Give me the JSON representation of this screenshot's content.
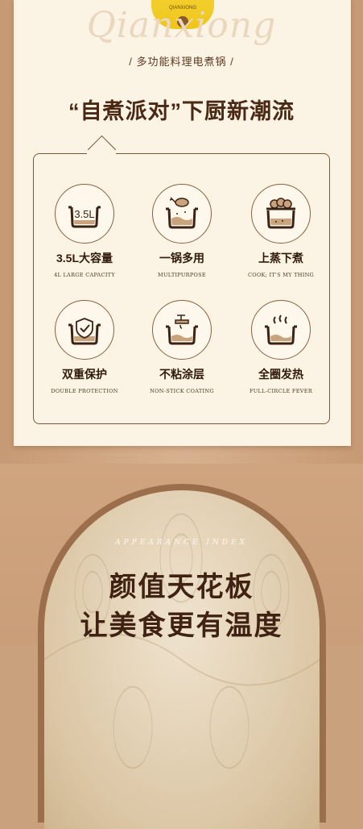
{
  "product": {
    "brand": "QIANXIONG"
  },
  "logo_script": "Qianxiong",
  "subtitle": "/ 多功能料理电煮锅 /",
  "headline": "“自煮派对”下厨新潮流",
  "features": [
    {
      "title": "3.5L大容量",
      "subtitle": "4L LARGE CAPACITY",
      "icon": "pot-capacity-icon",
      "badge": "3.5L"
    },
    {
      "title": "一锅多用",
      "subtitle": "MULTIPURPOSE",
      "icon": "pot-chicken-icon"
    },
    {
      "title": "上蒸下煮",
      "subtitle": "COOK; IT'S MY THING",
      "icon": "pot-steam-buns-icon"
    },
    {
      "title": "双重保护",
      "subtitle": "DOUBLE PROTECTION",
      "icon": "pot-shield-icon"
    },
    {
      "title": "不粘涂层",
      "subtitle": "NON-STICK COATING",
      "icon": "pot-faucet-icon"
    },
    {
      "title": "全圈发热",
      "subtitle": "FULL-CIRCLE FEVER",
      "icon": "pot-heat-icon"
    }
  ],
  "appearance_label": "APPEARANCE INDEX",
  "bottom_title": [
    "颜值天花板",
    "让美食更有温度"
  ],
  "colors": {
    "card": "#fbf3e4",
    "accent_brown": "#4a2814",
    "product_yellow": "#f2cd2a"
  }
}
